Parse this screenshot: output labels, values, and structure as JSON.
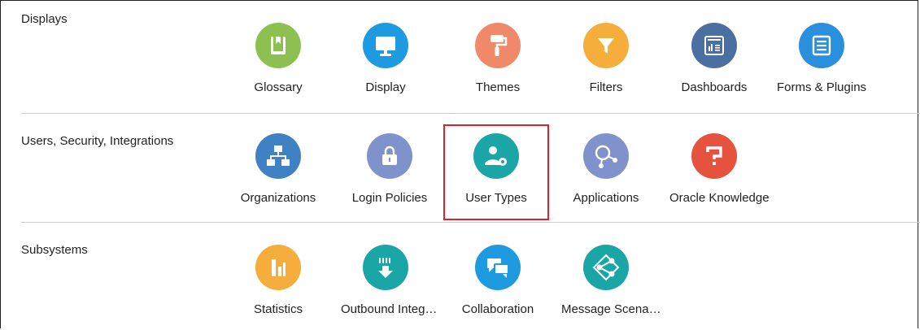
{
  "sections": [
    {
      "title": "Displays",
      "items": [
        {
          "label": "Glossary",
          "icon": "glossary-book-icon",
          "color": "#8cc152"
        },
        {
          "label": "Display",
          "icon": "monitor-icon",
          "color": "#1e9ae0"
        },
        {
          "label": "Themes",
          "icon": "paint-roller-icon",
          "color": "#f0896a"
        },
        {
          "label": "Filters",
          "icon": "funnel-icon",
          "color": "#f5ad3b"
        },
        {
          "label": "Dashboards",
          "icon": "dashboard-icon",
          "color": "#4a6fa0"
        },
        {
          "label": "Forms & Plugins",
          "icon": "form-icon",
          "color": "#2a8fdc"
        }
      ]
    },
    {
      "title": "Users, Security, Integrations",
      "items": [
        {
          "label": "Organizations",
          "icon": "org-chart-icon",
          "color": "#3f82c4"
        },
        {
          "label": "Login Policies",
          "icon": "lock-icon",
          "color": "#7f92cc"
        },
        {
          "label": "User Types",
          "icon": "user-gear-icon",
          "color": "#1aa5a7"
        },
        {
          "label": "Applications",
          "icon": "applications-icon",
          "color": "#7f92cc"
        },
        {
          "label": "Oracle Knowledge",
          "icon": "question-icon",
          "color": "#e5533f"
        }
      ]
    },
    {
      "title": "Subsystems",
      "items": [
        {
          "label": "Statistics",
          "icon": "bar-chart-icon",
          "color": "#f5ad3b"
        },
        {
          "label": "Outbound Integ…",
          "icon": "outbound-arrow-icon",
          "color": "#1aa5a7"
        },
        {
          "label": "Collaboration",
          "icon": "chat-bubbles-icon",
          "color": "#1e9ae0"
        },
        {
          "label": "Message Scena…",
          "icon": "share-icon",
          "color": "#1aa5a7"
        }
      ]
    }
  ]
}
